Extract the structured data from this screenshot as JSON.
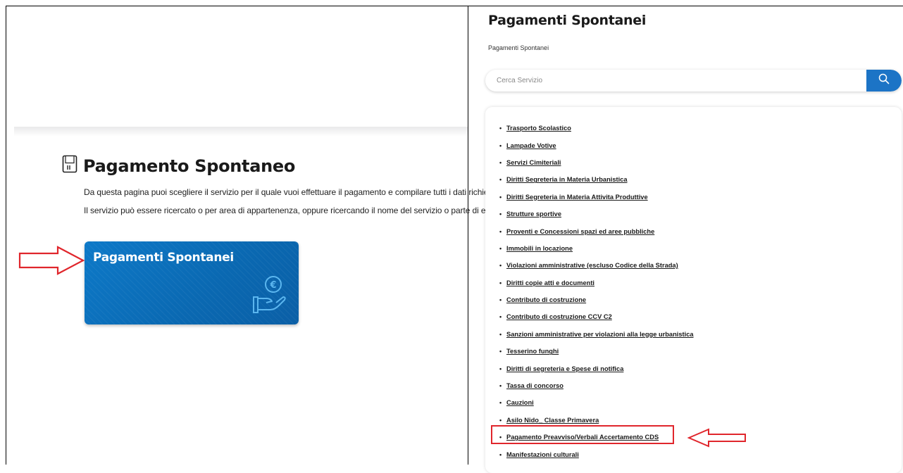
{
  "left": {
    "page_title": "Pagamento Spontaneo",
    "page_icon": "card-reader-icon",
    "description_line1": "Da questa pagina puoi scegliere il servizio per il quale vuoi effettuare il pagamento e compilare tutti i dati richiesti.",
    "description_line2": "Il servizio può essere ricercato o per area di appartenenza, oppure ricercando il nome del servizio o parte di esso.",
    "card": {
      "title": "Pagamenti Spontanei",
      "icon": "hand-euro-icon",
      "color": "#0a6bb6"
    }
  },
  "right": {
    "title": "Pagamenti Spontanei",
    "breadcrumb": "Pagamenti Spontanei",
    "search": {
      "placeholder": "Cerca Servizio",
      "button_icon": "search-icon",
      "button_color": "#1c74c6"
    },
    "services": [
      "Trasporto Scolastico",
      "Lampade Votive",
      "Servizi Cimiteriali",
      "Diritti Segreteria in Materia Urbanistica",
      "Diritti Segreteria in Materia Attivita Produttive",
      "Strutture sportive",
      "Proventi e Concessioni spazi ed aree pubbliche",
      "Immobili in locazione",
      "Violazioni amministrative (escluso Codice della Strada)",
      "Diritti copie atti e documenti",
      "Contributo di costruzione",
      "Contributo di costruzione CCV C2",
      "Sanzioni amministrative per violazioni alla legge urbanistica",
      "Tesserino funghi",
      "Diritti di segreteria e Spese di notifica",
      "Tassa di concorso",
      "Cauzioni",
      "Asilo Nido_ Classe Primavera",
      "Pagamento Preavviso/Verbali Accertamento CDS",
      "Manifestazioni culturali"
    ],
    "highlighted_service": "Pagamento Preavviso/Verbali Accertamento CDS"
  },
  "annotation_color": "#e0262c"
}
